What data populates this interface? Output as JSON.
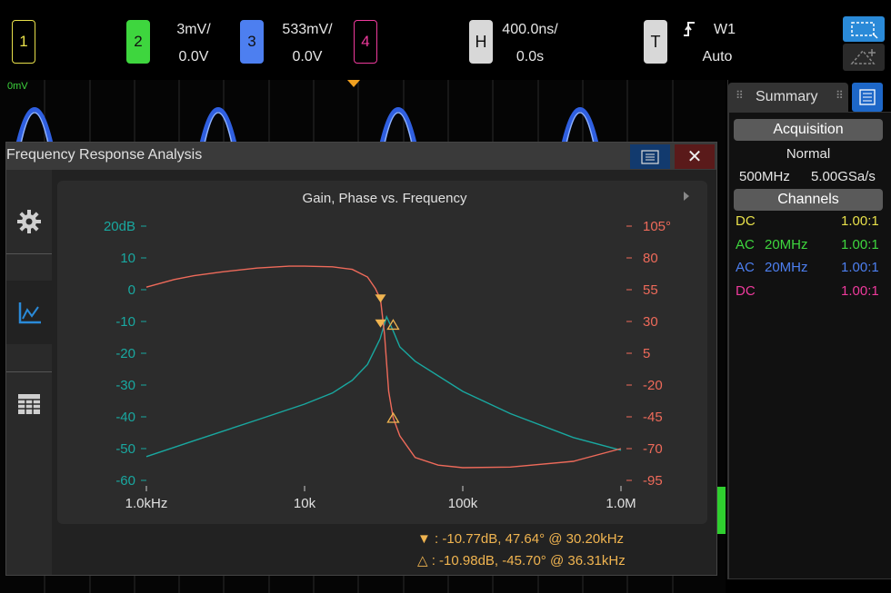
{
  "channels": [
    {
      "num": "1",
      "color": "#e8e04a",
      "filled": false,
      "scale": "",
      "offset": ""
    },
    {
      "num": "2",
      "color": "#3ed63e",
      "filled": true,
      "scale": "3mV/",
      "offset": "0.0V"
    },
    {
      "num": "3",
      "color": "#4d7ff0",
      "filled": true,
      "scale": "533mV/",
      "offset": "0.0V"
    },
    {
      "num": "4",
      "color": "#ee3a9c",
      "filled": false,
      "scale": "",
      "offset": ""
    }
  ],
  "horizontal": {
    "label": "H",
    "scale": "400.0ns/",
    "offset": "0.0s"
  },
  "trigger": {
    "label": "T",
    "source": "W1",
    "mode": "Auto",
    "slope_icon": "rising-edge-icon"
  },
  "waveform": {
    "ref_label": "0mV"
  },
  "fra": {
    "title": "Frequency Response Analysis",
    "close_label": "✕",
    "plot_title": "Gain, Phase vs. Frequency",
    "markers": [
      {
        "symbol": "▼",
        "text": ":  -10.77dB, 47.64° @ 30.20kHz"
      },
      {
        "symbol": "△",
        "text": ":  -10.98dB, -45.70° @ 36.31kHz"
      }
    ]
  },
  "summary": {
    "tab_label": "Summary",
    "acquisition_label": "Acquisition",
    "mode": "Normal",
    "bandwidth": "500MHz",
    "sample_rate": "5.00GSa/s",
    "channels_label": "Channels",
    "rows": [
      {
        "coupling": "DC",
        "bw": "",
        "probe": "1.00:1",
        "color": "#e8e04a"
      },
      {
        "coupling": "AC",
        "bw": "20MHz",
        "probe": "1.00:1",
        "color": "#3ed63e"
      },
      {
        "coupling": "AC",
        "bw": "20MHz",
        "probe": "1.00:1",
        "color": "#4d7ff0"
      },
      {
        "coupling": "DC",
        "bw": "",
        "probe": "1.00:1",
        "color": "#ee3a9c"
      }
    ]
  },
  "chart_data": {
    "type": "line",
    "title": "Gain, Phase vs. Frequency",
    "x_scale": "log",
    "xlim": [
      1000,
      1000000
    ],
    "x_ticks": [
      1000,
      10000,
      100000,
      1000000
    ],
    "x_tick_labels": [
      "1.0kHz",
      "10k",
      "100k",
      "1.0M"
    ],
    "y_left": {
      "ylim": [
        -60,
        20
      ],
      "tick_labels": [
        "20dB",
        "10",
        "0",
        "-10",
        "-20",
        "-30",
        "-40",
        "-50",
        "-60"
      ],
      "color": "#19a8a0"
    },
    "y_right": {
      "ylim": [
        -95,
        105
      ],
      "tick_labels": [
        "105°",
        "80",
        "55",
        "30",
        "5",
        "-20",
        "-45",
        "-70",
        "-95"
      ],
      "color": "#ee6a5a"
    },
    "series": [
      {
        "axis": "left",
        "color": "#19a8a0",
        "x": [
          1000,
          2000,
          5000,
          10000,
          15000,
          20000,
          25000,
          30000,
          33000,
          36000,
          40000,
          50000,
          100000,
          200000,
          500000,
          1000000
        ],
        "y": [
          -52.5,
          -47.5,
          -41,
          -36,
          -32.5,
          -28.5,
          -23.5,
          -15.5,
          -8.5,
          -12.5,
          -18,
          -22.5,
          -32,
          -39,
          -46.5,
          -50.5
        ]
      },
      {
        "axis": "right",
        "color": "#ee6a5a",
        "x": [
          1000,
          1500,
          2000,
          3000,
          5000,
          8000,
          10000,
          15000,
          20000,
          25000,
          28000,
          30200,
          32000,
          34000,
          36310,
          40000,
          50000,
          70000,
          100000,
          200000,
          500000,
          1000000
        ],
        "y": [
          57,
          63,
          66,
          69,
          72,
          73.5,
          73.5,
          73,
          71,
          65,
          56,
          47.6,
          20,
          -25,
          -45.7,
          -60,
          -77,
          -83,
          -85,
          -84.5,
          -80,
          -70
        ]
      }
    ],
    "marker_points": [
      {
        "symbol": "filled-triangle-down",
        "freq": 30200,
        "gain_db": -10.77,
        "phase_deg": 47.64
      },
      {
        "symbol": "open-triangle-up",
        "freq": 36310,
        "gain_db": -10.98,
        "phase_deg": -45.7
      }
    ]
  },
  "colors": {
    "accent_blue": "#2a8ad8",
    "gain": "#19a8a0",
    "phase": "#ee6a5a",
    "marker": "#f0b450"
  }
}
